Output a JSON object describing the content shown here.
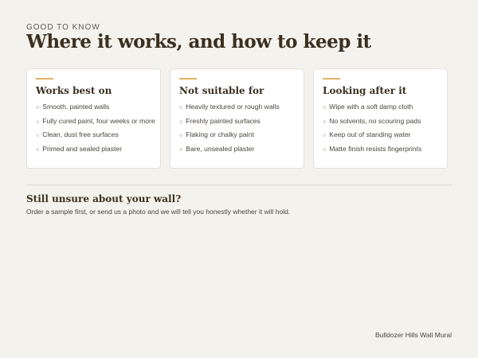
{
  "header": {
    "eyebrow": "GOOD TO KNOW",
    "title": "Where it works, and how to keep it"
  },
  "cards": [
    {
      "title": "Works best on",
      "items": [
        "Smooth, painted walls",
        "Fully cured paint, four weeks or more",
        "Clean, dust free surfaces",
        "Primed and sealed plaster"
      ]
    },
    {
      "title": "Not suitable for",
      "items": [
        "Heavily textured or rough walls",
        "Freshly painted surfaces",
        "Flaking or chalky paint",
        "Bare, unsealed plaster"
      ]
    },
    {
      "title": "Looking after it",
      "items": [
        "Wipe with a soft damp cloth",
        "No solvents, no scouring pads",
        "Keep out of standing water",
        "Matte finish resists fingerprints"
      ]
    }
  ],
  "unsure": {
    "title": "Still unsure about your wall?",
    "text": "Order a sample first, or send us a photo and we will tell you honestly whether it will hold."
  },
  "footer": {
    "brand": "Bulldozer Hills Wall Mural"
  },
  "colors": {
    "background": "#f4f2ed",
    "accent": "#e0b264",
    "heading": "#3b2f20"
  },
  "icons": {
    "bullet": "○"
  }
}
